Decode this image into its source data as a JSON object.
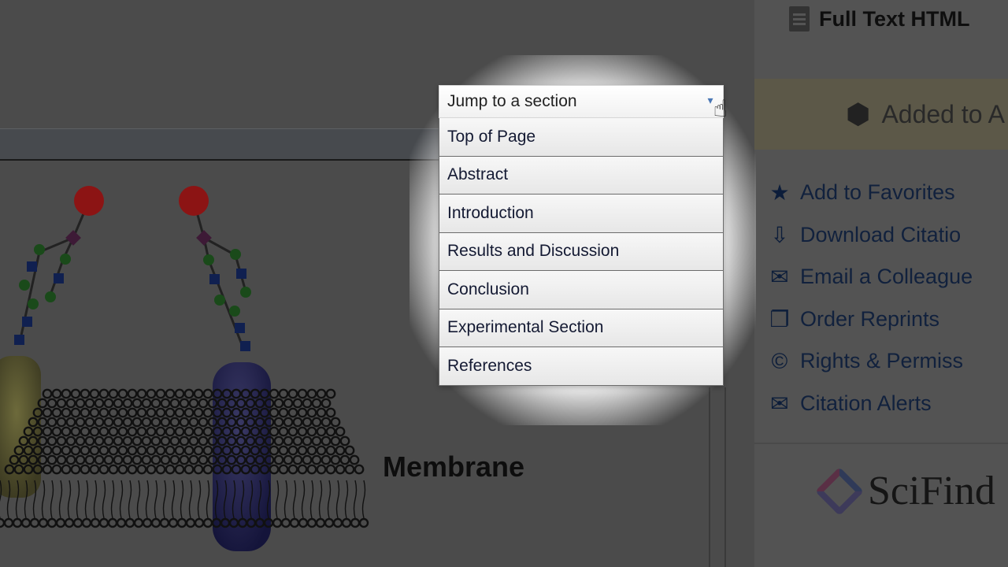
{
  "figure": {
    "label": "Membrane"
  },
  "dropdown": {
    "placeholder": "Jump to a section",
    "options": [
      "Top of Page",
      "Abstract",
      "Introduction",
      "Results and Discussion",
      "Conclusion",
      "Experimental Section",
      "References"
    ]
  },
  "sidebar": {
    "full_text_label": "Full Text HTML",
    "added_label": "Added to A",
    "actions": [
      {
        "label": "Add to Favorites",
        "icon": "star-icon"
      },
      {
        "label": "Download Citatio",
        "icon": "download-icon"
      },
      {
        "label": "Email a Colleague",
        "icon": "envelope-icon"
      },
      {
        "label": "Order Reprints",
        "icon": "reprints-icon"
      },
      {
        "label": "Rights & Permiss",
        "icon": "copyright-icon"
      },
      {
        "label": "Citation Alerts",
        "icon": "envelope-icon"
      }
    ],
    "brand": "SciFind"
  }
}
